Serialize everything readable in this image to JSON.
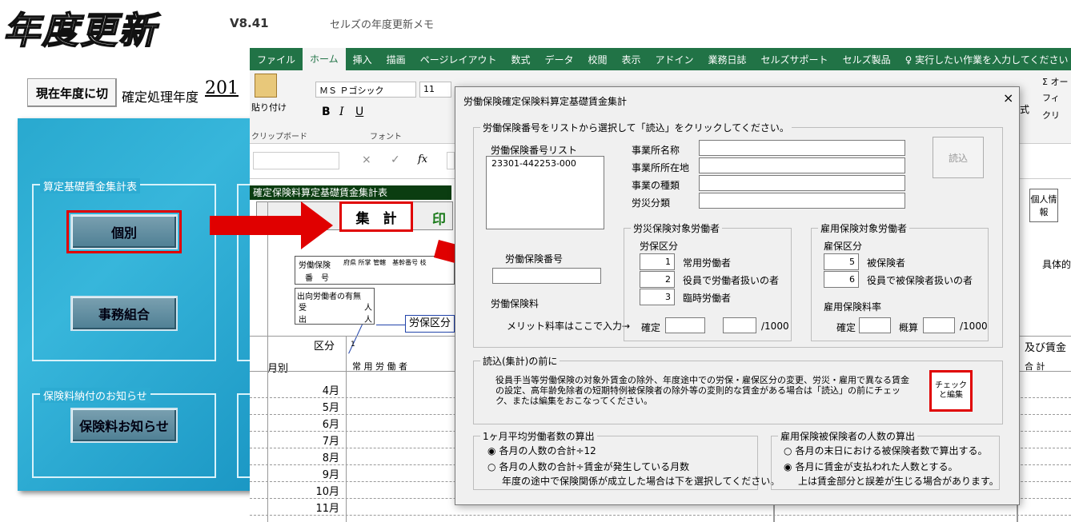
{
  "app": {
    "title": "年度更新",
    "version": "V8.41",
    "subtitle": "セルズの年度更新メモ",
    "switch_year_label": "現在年度に切",
    "fixed_year_label": "確定処理年度",
    "fixed_year_value": "201"
  },
  "menu": {
    "group1_label": "算定基礎賃金集計表",
    "kobetsu_label": "個別",
    "jimu_label": "事務組合",
    "group2_label": "保険料納付のお知らせ",
    "notice_label": "保険料お知らせ"
  },
  "excel": {
    "tabs": [
      "ファイル",
      "ホーム",
      "挿入",
      "描画",
      "ページレイアウト",
      "数式",
      "データ",
      "校閲",
      "表示",
      "アドイン",
      "業務日誌",
      "セルズサポート",
      "セルズ製品",
      "♀ 実行したい作業を入力してください"
    ],
    "active_tab_index": 1,
    "ribbon": {
      "paste": "貼り付け",
      "clipboard": "クリップボード",
      "font_name": "ＭＳ Ｐゴシック",
      "font_size": "11",
      "font_group": "フォント",
      "bold": "B",
      "italic": "I",
      "underline": "U",
      "formula_fx": "fx",
      "right_text1": "オー",
      "right_text2": "フィ",
      "right_text3": "クリ",
      "right_text4": "式"
    },
    "sheet": {
      "title": "確定保険料算定基礎賃金集計表",
      "aggregate_btn": "集　計",
      "print_btn": "印",
      "personal_info": "個人情報",
      "specific": "具体的",
      "labor_insurance": "労働保険",
      "number": "番　号",
      "pref_header": "府県 所掌 管轄　基幹番号 枝",
      "dispatch": "出向労働者の有無",
      "receive": "受",
      "send": "出",
      "person": "人",
      "rohokubun_callout": "労保区分",
      "kubun": "区分",
      "month_label": "月別",
      "regular_worker": "常 用 労 働 者",
      "wage_header": "及び賃金",
      "total": "合 計",
      "one": "1",
      "months": [
        "4月",
        "5月",
        "6月",
        "7月",
        "8月",
        "9月",
        "10月",
        "11月"
      ]
    }
  },
  "dialog": {
    "title": "労働保険確定保険料算定基礎賃金集計",
    "close": "×",
    "select_legend": "労働保険番号をリストから選択して「読込」をクリックしてください。",
    "list_label": "労働保険番号リスト",
    "list_items": [
      "23301-442253-000"
    ],
    "office_name": "事業所名称",
    "office_address": "事業所所在地",
    "business_type": "事業の種類",
    "rousai_class": "労災分類",
    "load_btn": "読込",
    "insurance_number": "労働保険番号",
    "insurance_fee": "労働保険料",
    "merit_text": "メリット料率はここで入力→",
    "rousai_legend": "労災保険対象労働者",
    "roho_kubun": "労保区分",
    "rousai_rows": [
      {
        "num": "1",
        "label": "常用労働者"
      },
      {
        "num": "2",
        "label": "役員で労働者扱いの者"
      },
      {
        "num": "3",
        "label": "臨時労働者"
      }
    ],
    "kakutei": "確定",
    "per_1000": "/1000",
    "koyo_legend": "雇用保険対象労働者",
    "koho_kubun": "雇保区分",
    "koyo_rows": [
      {
        "num": "5",
        "label": "被保険者"
      },
      {
        "num": "6",
        "label": "役員で被保険者扱いの者"
      }
    ],
    "koyo_rate": "雇用保険料率",
    "gaisan": "概算",
    "before_legend": "読込(集計)の前に",
    "before_text": "役員手当等労働保険の対象外賃金の除外、年度途中での労保・雇保区分の変更、労災・雇用で異なる賃金の設定、高年齢免除者の短期特例被保険者の除外等の変則的な賃金がある場合は「読込」の前にチェック、または編集をおこなってください。",
    "check_btn": "チェックと編集",
    "avg_legend": "1ヶ月平均労働者数の算出",
    "avg_opt1": "各月の人数の合計÷12",
    "avg_opt2": "各月の人数の合計÷賃金が発生している月数",
    "avg_note": "年度の途中で保険関係が成立した場合は下を選択してください。",
    "koyo_count_legend": "雇用保険被保険者の人数の算出",
    "koyo_opt1": "各月の末日における被保険者数で算出する。",
    "koyo_opt2": "各月に賃金が支払われた人数とする。",
    "koyo_note": "上は賃金部分と誤差が生じる場合があります。"
  },
  "colors": {
    "excel_green": "#217346",
    "highlight_red": "#e00000",
    "panel_blue": "#29a9cf"
  }
}
